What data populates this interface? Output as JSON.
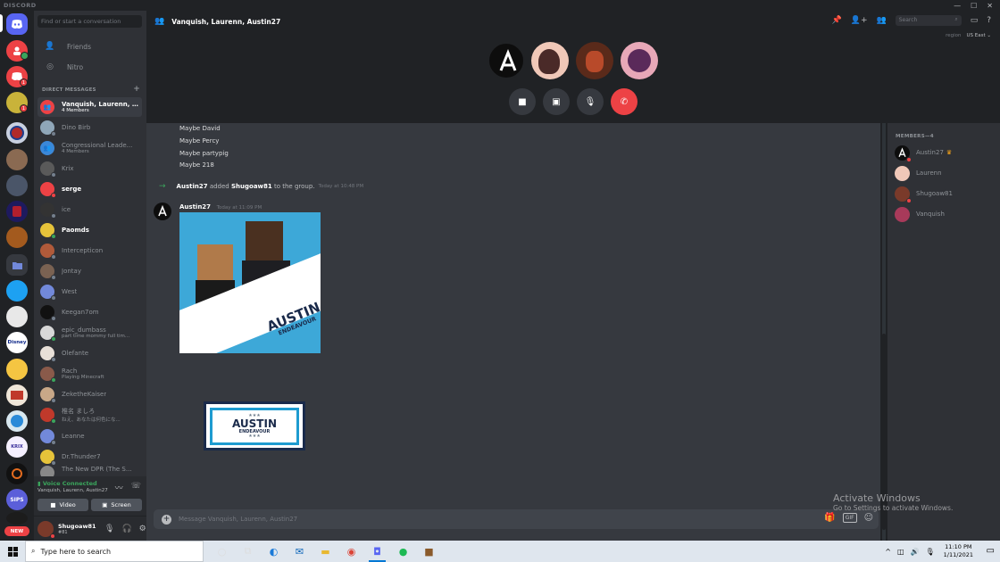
{
  "titlebar": {
    "brand": "DISCORD",
    "minimize": "—",
    "maximize": "☐",
    "close": "✕"
  },
  "guilds": {
    "new_label": "NEW",
    "badge_1": "1",
    "badge_2": "1"
  },
  "dm_panel": {
    "search_placeholder": "Find or start a conversation",
    "friends": "Friends",
    "nitro": "Nitro",
    "section_header": "DIRECT MESSAGES",
    "add": "+",
    "items": [
      {
        "name": "Vanquish, Laurenn, A...",
        "sub": "4 Members"
      },
      {
        "name": "Dino Birb",
        "sub": ""
      },
      {
        "name": "Congressional Leade...",
        "sub": "4 Members"
      },
      {
        "name": "Krix",
        "sub": ""
      },
      {
        "name": "serge",
        "sub": ""
      },
      {
        "name": "ice",
        "sub": ""
      },
      {
        "name": "Paomds",
        "sub": ""
      },
      {
        "name": "Intercepticon",
        "sub": ""
      },
      {
        "name": "Jontay",
        "sub": ""
      },
      {
        "name": "West",
        "sub": ""
      },
      {
        "name": "Keegan7om",
        "sub": ""
      },
      {
        "name": "epic_dumbass",
        "sub": "part time mommy full tim..."
      },
      {
        "name": "Olefante",
        "sub": ""
      },
      {
        "name": "Rach",
        "sub": "Playing Minecraft"
      },
      {
        "name": "ZeketheKaiser",
        "sub": ""
      },
      {
        "name": "椎名 ましろ",
        "sub": "ねえ、あなたは何色にな..."
      },
      {
        "name": "Leanne",
        "sub": ""
      },
      {
        "name": "Dr.Thunder7",
        "sub": ""
      },
      {
        "name": "The New DPR (The S...",
        "sub": ""
      }
    ],
    "voice": {
      "status": "Voice Connected",
      "channel": "Vanquish, Laurenn, Austin27",
      "video": "Video",
      "screen": "Screen"
    },
    "user": {
      "name": "Shugoaw81",
      "tag": "#81"
    }
  },
  "header": {
    "title": "Vanquish, Laurenn, Austin27",
    "search_placeholder": "Search"
  },
  "call": {
    "region_label": "region",
    "region_value": "US East ⌄"
  },
  "chat": {
    "messages": [
      "Maybe David",
      "Maybe Percy",
      "Maybe partypig",
      "Maybe 218"
    ],
    "system": {
      "actor": "Austin27",
      "verb": "added",
      "target": "Shugoaw81",
      "rest": "to the group.",
      "time": "Today at 10:48 PM"
    },
    "post": {
      "author": "Austin27",
      "time": "Today at 11:09 PM"
    },
    "image1": {
      "title": "AUSTIN",
      "subtitle": "ENDEAVOUR"
    },
    "image2": {
      "title": "AUSTIN",
      "subtitle": "ENDEAVOUR",
      "stars": "★★★"
    },
    "composer_placeholder": "Message Vanquish, Laurenn, Austin27",
    "gif": "GIF"
  },
  "members": {
    "header": "MEMBERS—4",
    "list": [
      "Austin27",
      "Laurenn",
      "Shugoaw81",
      "Vanquish"
    ]
  },
  "watermark": {
    "line1": "Activate Windows",
    "line2": "Go to Settings to activate Windows."
  },
  "taskbar": {
    "search_placeholder": "Type here to search",
    "time": "11:10 PM",
    "date": "1/11/2021"
  }
}
